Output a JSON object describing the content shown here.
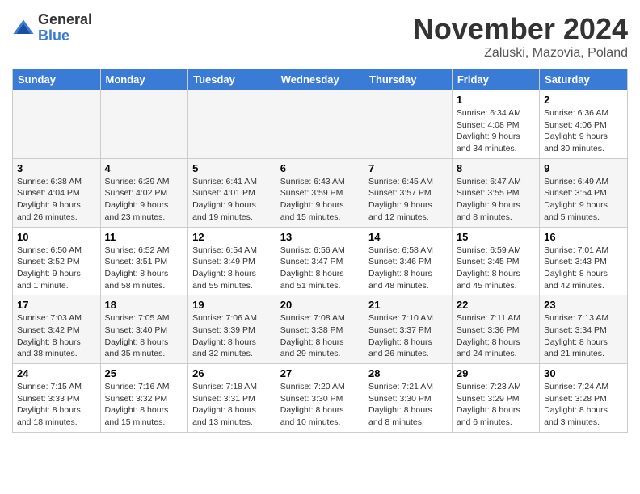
{
  "logo": {
    "general": "General",
    "blue": "Blue"
  },
  "header": {
    "month": "November 2024",
    "location": "Zaluski, Mazovia, Poland"
  },
  "weekdays": [
    "Sunday",
    "Monday",
    "Tuesday",
    "Wednesday",
    "Thursday",
    "Friday",
    "Saturday"
  ],
  "weeks": [
    [
      {
        "day": "",
        "info": ""
      },
      {
        "day": "",
        "info": ""
      },
      {
        "day": "",
        "info": ""
      },
      {
        "day": "",
        "info": ""
      },
      {
        "day": "",
        "info": ""
      },
      {
        "day": "1",
        "info": "Sunrise: 6:34 AM\nSunset: 4:08 PM\nDaylight: 9 hours and 34 minutes."
      },
      {
        "day": "2",
        "info": "Sunrise: 6:36 AM\nSunset: 4:06 PM\nDaylight: 9 hours and 30 minutes."
      }
    ],
    [
      {
        "day": "3",
        "info": "Sunrise: 6:38 AM\nSunset: 4:04 PM\nDaylight: 9 hours and 26 minutes."
      },
      {
        "day": "4",
        "info": "Sunrise: 6:39 AM\nSunset: 4:02 PM\nDaylight: 9 hours and 23 minutes."
      },
      {
        "day": "5",
        "info": "Sunrise: 6:41 AM\nSunset: 4:01 PM\nDaylight: 9 hours and 19 minutes."
      },
      {
        "day": "6",
        "info": "Sunrise: 6:43 AM\nSunset: 3:59 PM\nDaylight: 9 hours and 15 minutes."
      },
      {
        "day": "7",
        "info": "Sunrise: 6:45 AM\nSunset: 3:57 PM\nDaylight: 9 hours and 12 minutes."
      },
      {
        "day": "8",
        "info": "Sunrise: 6:47 AM\nSunset: 3:55 PM\nDaylight: 9 hours and 8 minutes."
      },
      {
        "day": "9",
        "info": "Sunrise: 6:49 AM\nSunset: 3:54 PM\nDaylight: 9 hours and 5 minutes."
      }
    ],
    [
      {
        "day": "10",
        "info": "Sunrise: 6:50 AM\nSunset: 3:52 PM\nDaylight: 9 hours and 1 minute."
      },
      {
        "day": "11",
        "info": "Sunrise: 6:52 AM\nSunset: 3:51 PM\nDaylight: 8 hours and 58 minutes."
      },
      {
        "day": "12",
        "info": "Sunrise: 6:54 AM\nSunset: 3:49 PM\nDaylight: 8 hours and 55 minutes."
      },
      {
        "day": "13",
        "info": "Sunrise: 6:56 AM\nSunset: 3:47 PM\nDaylight: 8 hours and 51 minutes."
      },
      {
        "day": "14",
        "info": "Sunrise: 6:58 AM\nSunset: 3:46 PM\nDaylight: 8 hours and 48 minutes."
      },
      {
        "day": "15",
        "info": "Sunrise: 6:59 AM\nSunset: 3:45 PM\nDaylight: 8 hours and 45 minutes."
      },
      {
        "day": "16",
        "info": "Sunrise: 7:01 AM\nSunset: 3:43 PM\nDaylight: 8 hours and 42 minutes."
      }
    ],
    [
      {
        "day": "17",
        "info": "Sunrise: 7:03 AM\nSunset: 3:42 PM\nDaylight: 8 hours and 38 minutes."
      },
      {
        "day": "18",
        "info": "Sunrise: 7:05 AM\nSunset: 3:40 PM\nDaylight: 8 hours and 35 minutes."
      },
      {
        "day": "19",
        "info": "Sunrise: 7:06 AM\nSunset: 3:39 PM\nDaylight: 8 hours and 32 minutes."
      },
      {
        "day": "20",
        "info": "Sunrise: 7:08 AM\nSunset: 3:38 PM\nDaylight: 8 hours and 29 minutes."
      },
      {
        "day": "21",
        "info": "Sunrise: 7:10 AM\nSunset: 3:37 PM\nDaylight: 8 hours and 26 minutes."
      },
      {
        "day": "22",
        "info": "Sunrise: 7:11 AM\nSunset: 3:36 PM\nDaylight: 8 hours and 24 minutes."
      },
      {
        "day": "23",
        "info": "Sunrise: 7:13 AM\nSunset: 3:34 PM\nDaylight: 8 hours and 21 minutes."
      }
    ],
    [
      {
        "day": "24",
        "info": "Sunrise: 7:15 AM\nSunset: 3:33 PM\nDaylight: 8 hours and 18 minutes."
      },
      {
        "day": "25",
        "info": "Sunrise: 7:16 AM\nSunset: 3:32 PM\nDaylight: 8 hours and 15 minutes."
      },
      {
        "day": "26",
        "info": "Sunrise: 7:18 AM\nSunset: 3:31 PM\nDaylight: 8 hours and 13 minutes."
      },
      {
        "day": "27",
        "info": "Sunrise: 7:20 AM\nSunset: 3:30 PM\nDaylight: 8 hours and 10 minutes."
      },
      {
        "day": "28",
        "info": "Sunrise: 7:21 AM\nSunset: 3:30 PM\nDaylight: 8 hours and 8 minutes."
      },
      {
        "day": "29",
        "info": "Sunrise: 7:23 AM\nSunset: 3:29 PM\nDaylight: 8 hours and 6 minutes."
      },
      {
        "day": "30",
        "info": "Sunrise: 7:24 AM\nSunset: 3:28 PM\nDaylight: 8 hours and 3 minutes."
      }
    ]
  ]
}
